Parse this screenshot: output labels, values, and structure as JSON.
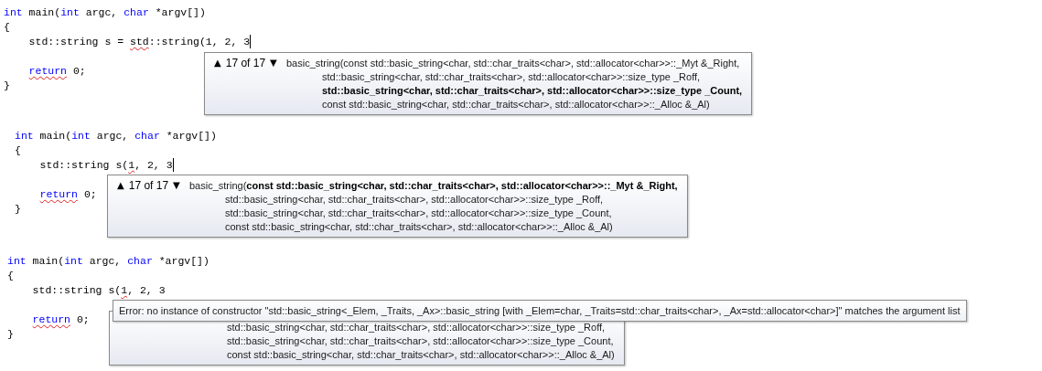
{
  "panels": [
    {
      "code": [
        {
          "kind": "code",
          "caret": false,
          "tokens": [
            {
              "text": "int",
              "kind": "keyword"
            },
            {
              "text": " main(",
              "kind": "plain"
            },
            {
              "text": "int",
              "kind": "keyword"
            },
            {
              "text": " argc, ",
              "kind": "plain"
            },
            {
              "text": "char",
              "kind": "keyword"
            },
            {
              "text": " *argv[])",
              "kind": "plain"
            }
          ]
        },
        {
          "kind": "code",
          "caret": false,
          "tokens": [
            {
              "text": "{",
              "kind": "plain"
            }
          ]
        },
        {
          "kind": "code",
          "indented": true,
          "caret": true,
          "tokens": [
            {
              "text": "std::string s = ",
              "kind": "plain"
            },
            {
              "text": "std",
              "kind": "error-plain"
            },
            {
              "text": "::string(1, 2, 3",
              "kind": "plain"
            }
          ]
        },
        {
          "kind": "blank"
        },
        {
          "kind": "code",
          "indented": true,
          "caret": false,
          "tokens": [
            {
              "text": "return",
              "kind": "error-keyword"
            },
            {
              "text": " 0;",
              "kind": "plain"
            }
          ]
        },
        {
          "kind": "code",
          "caret": false,
          "tokens": [
            {
              "text": "}",
              "kind": "plain"
            }
          ]
        }
      ],
      "signature_popup": {
        "prev": "▲",
        "counter": "17 of 17",
        "next": "▼",
        "name": "basic_string(",
        "params": [
          {
            "text": "const std::basic_string<char, std::char_traits<char>, std::allocator<char>>::_Myt &_Right,",
            "selected": false
          },
          {
            "text": "std::basic_string<char, std::char_traits<char>, std::allocator<char>>::size_type _Roff,",
            "selected": false
          },
          {
            "text": "std::basic_string<char, std::char_traits<char>, std::allocator<char>>::size_type _Count,",
            "selected": true
          },
          {
            "text": "const std::basic_string<char, std::char_traits<char>, std::allocator<char>>::_Alloc &_Al)",
            "selected": false
          }
        ]
      }
    },
    {
      "code": [
        {
          "kind": "code",
          "caret": false,
          "tokens": [
            {
              "text": "int",
              "kind": "keyword"
            },
            {
              "text": " main(",
              "kind": "plain"
            },
            {
              "text": "int",
              "kind": "keyword"
            },
            {
              "text": " argc, ",
              "kind": "plain"
            },
            {
              "text": "char",
              "kind": "keyword"
            },
            {
              "text": " *argv[])",
              "kind": "plain"
            }
          ]
        },
        {
          "kind": "code",
          "caret": false,
          "tokens": [
            {
              "text": "{",
              "kind": "plain"
            }
          ]
        },
        {
          "kind": "code",
          "indented": true,
          "caret": true,
          "tokens": [
            {
              "text": "std::string s(",
              "kind": "plain"
            },
            {
              "text": "1",
              "kind": "error-plain"
            },
            {
              "text": ", 2, 3",
              "kind": "plain"
            }
          ]
        },
        {
          "kind": "blank"
        },
        {
          "kind": "code",
          "indented": true,
          "caret": false,
          "tokens": [
            {
              "text": "return",
              "kind": "error-keyword"
            },
            {
              "text": " 0;",
              "kind": "plain"
            }
          ]
        },
        {
          "kind": "code",
          "caret": false,
          "tokens": [
            {
              "text": "}",
              "kind": "plain"
            }
          ]
        }
      ],
      "signature_popup": {
        "prev": "▲",
        "counter": "17 of 17",
        "next": "▼",
        "name": "basic_string(",
        "params": [
          {
            "text": "const std::basic_string<char, std::char_traits<char>, std::allocator<char>>::_Myt &_Right,",
            "selected": true
          },
          {
            "text": "std::basic_string<char, std::char_traits<char>, std::allocator<char>>::size_type _Roff,",
            "selected": false
          },
          {
            "text": "std::basic_string<char, std::char_traits<char>, std::allocator<char>>::size_type _Count,",
            "selected": false
          },
          {
            "text": "const std::basic_string<char, std::char_traits<char>, std::allocator<char>>::_Alloc &_Al)",
            "selected": false
          }
        ]
      }
    },
    {
      "code": [
        {
          "kind": "code",
          "caret": false,
          "tokens": [
            {
              "text": "int",
              "kind": "keyword"
            },
            {
              "text": " main(",
              "kind": "plain"
            },
            {
              "text": "int",
              "kind": "keyword"
            },
            {
              "text": " argc, ",
              "kind": "plain"
            },
            {
              "text": "char",
              "kind": "keyword"
            },
            {
              "text": " *argv[])",
              "kind": "plain"
            }
          ]
        },
        {
          "kind": "code",
          "caret": false,
          "tokens": [
            {
              "text": "{",
              "kind": "plain"
            }
          ]
        },
        {
          "kind": "code",
          "indented": true,
          "caret": false,
          "tokens": [
            {
              "text": "std::string s(",
              "kind": "plain"
            },
            {
              "text": "1",
              "kind": "error-plain"
            },
            {
              "text": ", 2, 3",
              "kind": "plain"
            }
          ]
        },
        {
          "kind": "blank"
        },
        {
          "kind": "code",
          "indented": true,
          "caret": false,
          "tokens": [
            {
              "text": "return",
              "kind": "error-keyword"
            },
            {
              "text": " 0;",
              "kind": "plain"
            }
          ]
        },
        {
          "kind": "code",
          "caret": false,
          "tokens": [
            {
              "text": "}",
              "kind": "plain"
            }
          ]
        }
      ],
      "signature_popup": {
        "params": [
          {
            "text": "std::basic_string<char, std::char_traits<char>, std::allocator<char>>::size_type _Roff,",
            "selected": false
          },
          {
            "text": "std::basic_string<char, std::char_traits<char>, std::allocator<char>>::size_type _Count,",
            "selected": false
          },
          {
            "text": "const std::basic_string<char, std::char_traits<char>, std::allocator<char>>::_Alloc &_Al)",
            "selected": false
          }
        ]
      },
      "error_tooltip": {
        "text": "Error: no instance of constructor \"std::basic_string<_Elem, _Traits, _Ax>::basic_string [with _Elem=char, _Traits=std::char_traits<char>, _Ax=std::allocator<char>]\" matches the argument list"
      }
    }
  ]
}
